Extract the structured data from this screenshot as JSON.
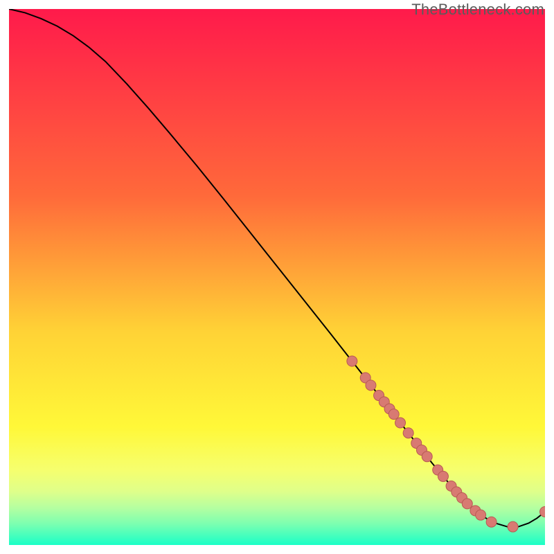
{
  "watermark": "TheBottleneck.com",
  "colors": {
    "gradient_top": "#ff1a4b",
    "gradient_mid_upper": "#ff6a3a",
    "gradient_mid": "#ffd236",
    "gradient_mid_lower": "#fff838",
    "gradient_band1": "#f6ff6e",
    "gradient_band2": "#dfff8a",
    "gradient_band3": "#b6ffa0",
    "gradient_band4": "#7dffb0",
    "gradient_bottom": "#1affc7",
    "curve": "#000000",
    "marker_fill": "#d87a72",
    "marker_stroke": "#b85a52"
  },
  "chart_data": {
    "type": "line",
    "title": "",
    "xlabel": "",
    "ylabel": "",
    "xlim": [
      0,
      100
    ],
    "ylim": [
      0,
      100
    ],
    "series": [
      {
        "name": "curve",
        "x": [
          0.0,
          3.0,
          6.0,
          9.0,
          12.0,
          15.0,
          18.0,
          22.0,
          26.0,
          30.0,
          35.0,
          40.0,
          45.0,
          50.0,
          55.0,
          60.0,
          64.0,
          68.0,
          72.0,
          76.0,
          79.0,
          81.0,
          84.0,
          87.0,
          90.0,
          93.0,
          95.0,
          97.0,
          98.5,
          100.0
        ],
        "y": [
          100.0,
          99.3,
          98.2,
          96.8,
          95.0,
          92.8,
          90.2,
          86.0,
          81.5,
          76.8,
          70.8,
          64.6,
          58.3,
          52.0,
          45.7,
          39.4,
          34.3,
          29.2,
          24.1,
          19.0,
          15.2,
          12.8,
          9.3,
          6.4,
          4.3,
          3.4,
          3.4,
          4.1,
          5.0,
          6.2
        ]
      }
    ],
    "markers": {
      "name": "highlighted-points",
      "x": [
        64.0,
        66.5,
        67.5,
        69.0,
        70.0,
        71.0,
        71.8,
        73.0,
        74.5,
        76.0,
        77.0,
        78.0,
        80.0,
        81.0,
        82.5,
        83.5,
        84.5,
        85.5,
        87.0,
        88.0,
        90.0,
        94.0,
        100.0
      ],
      "y": [
        34.3,
        31.2,
        29.8,
        27.9,
        26.7,
        25.4,
        24.4,
        22.8,
        20.9,
        19.0,
        17.7,
        16.5,
        14.0,
        12.8,
        11.0,
        9.9,
        8.8,
        7.7,
        6.4,
        5.6,
        4.3,
        3.4,
        6.2
      ]
    }
  }
}
